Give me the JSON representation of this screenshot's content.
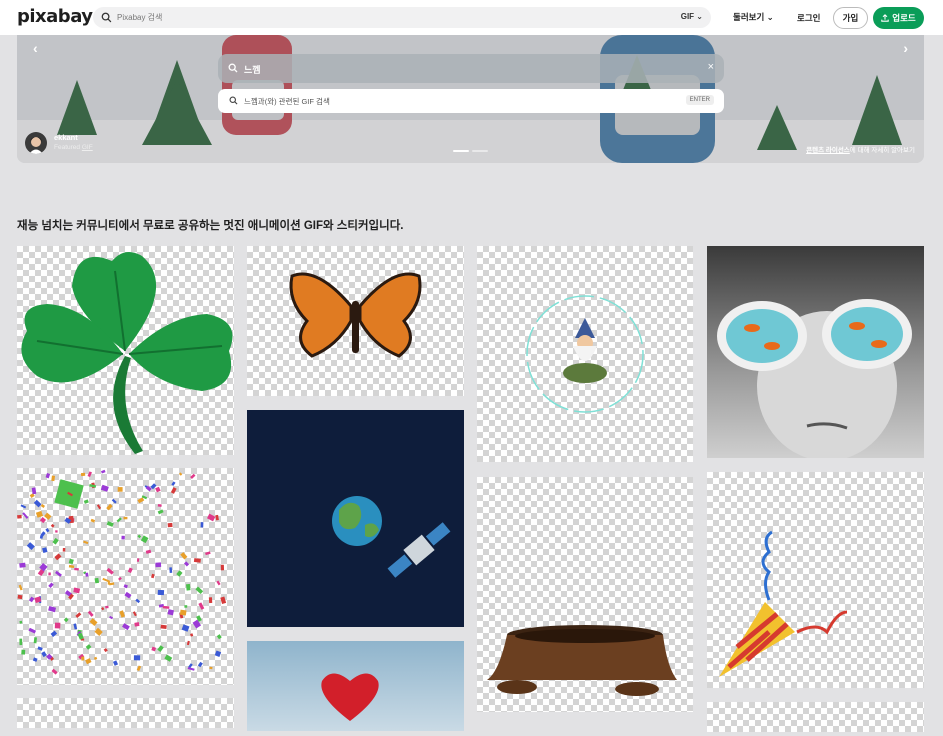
{
  "header": {
    "logo": "pixabay",
    "search_placeholder": "Pixabay 검색",
    "search_type": "GIF",
    "explore_label": "둘러보기",
    "login_label": "로그인",
    "join_label": "가입",
    "upload_label": "업로드"
  },
  "hero": {
    "query": "느껨",
    "suggestion": "느껨과(와) 관련된 GIF 검색",
    "enter_key": "ENTER",
    "author_name": "ekkant",
    "author_featured": "Featured",
    "author_featured_link": "GIF",
    "license_link": "콘텐츠 라이선스",
    "license_rest": "에 대해 자세히 알아보기",
    "active_slide": 1,
    "slide_count": 2
  },
  "tagline": "재능 넘치는 커뮤니티에서 무료로 공유하는 멋진 애니메이션 GIF와 스티커입니다.",
  "gallery": [
    {
      "icon": "clover-image"
    },
    {
      "icon": "butterfly-image"
    },
    {
      "icon": "wizard-bubble-image"
    },
    {
      "icon": "goggles-goldfish-image"
    },
    {
      "icon": "confetti-image"
    },
    {
      "icon": "earth-satellite-image"
    },
    {
      "icon": "heart-balloon-image"
    },
    {
      "icon": "mud-pot-image"
    },
    {
      "icon": "party-popper-image"
    }
  ],
  "colors": {
    "brand_green": "#0a9d58",
    "page_bg": "#e2e2e4",
    "space_navy": "#0e1d3b"
  }
}
